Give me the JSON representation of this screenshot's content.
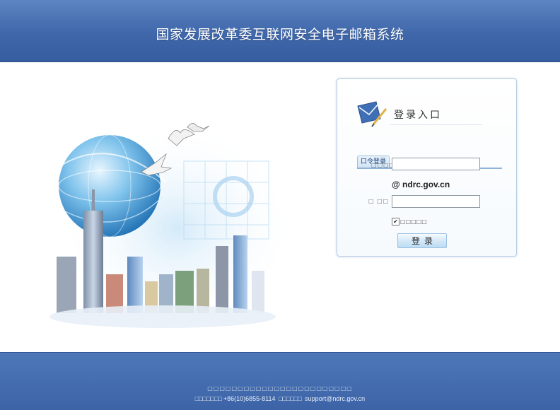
{
  "header": {
    "title": "国家发展改革委互联网安全电子邮箱系统"
  },
  "login": {
    "box_title": "登录入口",
    "tab_label": "口令登录",
    "username_label": "□□□□",
    "password_label": "□  □□",
    "domain": "@ ndrc.gov.cn",
    "username_value": "",
    "password_value": "",
    "remember_checked": true,
    "remember_label": "□□□□□",
    "login_button": "登录"
  },
  "footer": {
    "line1": "□□□□□□□□□□□□□□□□□□□□□□□□",
    "line2_prefix": "□□□□□□□",
    "phone": "+86(10)6855-8114",
    "line2_mid": "□□□□□□",
    "email": "support@ndrc.gov.cn"
  },
  "icons": [
    "login-envelope-icon",
    "checkbox-icon"
  ],
  "colors": {
    "header_blue": "#3f67aa",
    "footer_blue": "#3c63a6",
    "box_border": "#b9cfe4"
  }
}
